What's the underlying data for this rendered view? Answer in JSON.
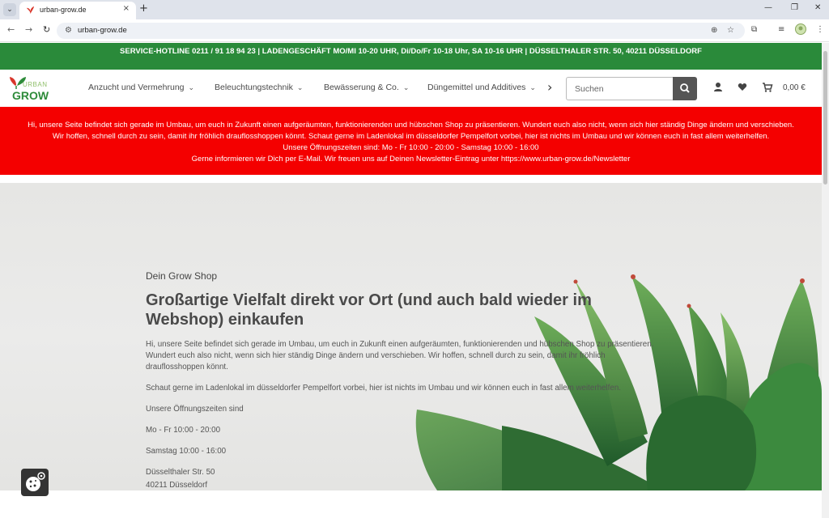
{
  "browser": {
    "tab_title": "urban-grow.de",
    "url": "urban-grow.de",
    "new_tab_label": "+",
    "close_label": "×"
  },
  "page": {
    "hotline": "SERVICE-HOTLINE 0211 / 91 18 94 23 | LADENGESCHÄFT MO/MI 10-20 UHR, Di/Do/Fr 10-18 Uhr, SA 10-16 UHR | DÜSSELTHALER STR. 50, 40211 DÜSSELDORF",
    "logo": {
      "top": "URBAN",
      "bottom": "GROW"
    },
    "nav": [
      {
        "label": "Anzucht und Vermehrung"
      },
      {
        "label": "Beleuchtungstechnik"
      },
      {
        "label": "Bewässerung & Co."
      },
      {
        "label": "Düngemittel und Additives"
      }
    ],
    "search": {
      "placeholder": "Suchen"
    },
    "cart": {
      "total": "0,00 €"
    },
    "notice": {
      "line1": "Hi, unsere Seite befindet sich gerade im Umbau, um euch in Zukunft einen aufgeräumten, funktionierenden und hübschen Shop zu präsentieren. Wundert euch also nicht, wenn sich hier ständig Dinge ändern und verschieben.",
      "line2": "Wir hoffen, schnell durch zu sein, damit ihr fröhlich drauflosshoppen könnt. Schaut gerne im Ladenlokal im düsseldorfer Pempelfort vorbei, hier ist nichts im Umbau und wir können euch in fast allem weiterhelfen.",
      "line3": "Unsere Öffnungszeiten sind: Mo - Fr 10:00 - 20:00 - Samstag 10:00 - 16:00",
      "line4": "Gerne informieren wir Dich per E-Mail. Wir freuen uns auf Deinen Newsletter-Eintrag unter https://www.urban-grow.de/Newsletter"
    },
    "hero": {
      "eyebrow": "Dein Grow Shop",
      "title": "Großartige Vielfalt direkt vor Ort (und auch bald wieder im Webshop) einkaufen",
      "p1": "Hi, unsere Seite befindet sich gerade im Umbau, um euch in Zukunft einen aufgeräumten, funktionierenden und hübschen Shop zu präsentieren. Wundert euch also nicht, wenn sich hier ständig Dinge ändern und verschieben. Wir hoffen, schnell durch zu sein, damit ihr fröhlich drauflosshoppen könnt.",
      "p2": "Schaut gerne im Ladenlokal im düsseldorfer Pempelfort vorbei, hier ist nichts im Umbau und wir können euch in fast allem weiterhelfen.",
      "p3": "Unsere Öffnungszeiten sind",
      "p4": "Mo - Fr 10:00 - 20:00",
      "p5": "Samstag 10:00 - 16:00",
      "p6": "Düsselthaler Str. 50",
      "p7": "40211 Düsseldorf"
    }
  },
  "colors": {
    "hotline_bg": "#2a8a3a",
    "notice_bg": "#f40000",
    "brand_green": "#2e8b3a",
    "brand_red": "#d9362b"
  }
}
